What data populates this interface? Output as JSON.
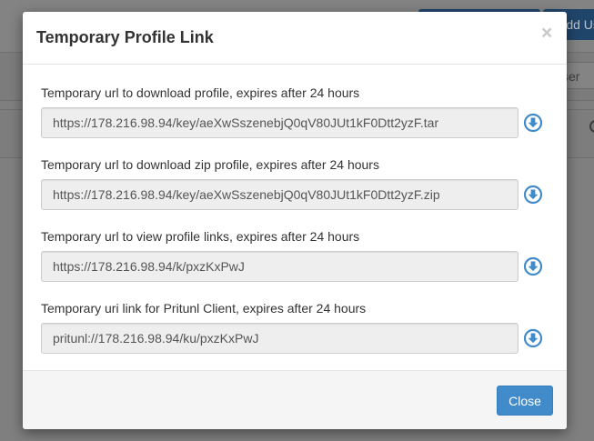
{
  "background": {
    "add_user_label": "Add Us",
    "user_button_label": "ser"
  },
  "modal": {
    "title": "Temporary Profile Link",
    "close_symbol": "×",
    "fields": [
      {
        "label": "Temporary url to download profile, expires after 24 hours",
        "value": "https://178.216.98.94/key/aeXwSszenebjQ0qV80JUt1kF0Dtt2yzF.tar"
      },
      {
        "label": "Temporary url to download zip profile, expires after 24 hours",
        "value": "https://178.216.98.94/key/aeXwSszenebjQ0qV80JUt1kF0Dtt2yzF.zip"
      },
      {
        "label": "Temporary url to view profile links, expires after 24 hours",
        "value": "https://178.216.98.94/k/pxzKxPwJ"
      },
      {
        "label": "Temporary uri link for Pritunl Client, expires after 24 hours",
        "value": "pritunl://178.216.98.94/ku/pxzKxPwJ"
      }
    ],
    "download_icon": "download-circle-icon",
    "close_button_label": "Close"
  },
  "colors": {
    "primary": "#428bca",
    "overlay": "#7f7f7f"
  }
}
